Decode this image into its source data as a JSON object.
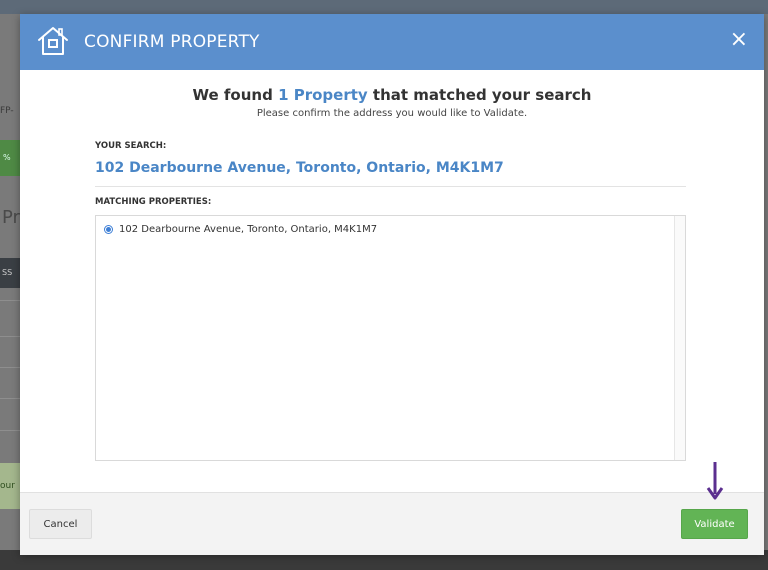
{
  "background": {
    "crumb_text": "FP-",
    "green_text": "%",
    "title_fragment": "Pr",
    "dark_text": "SS",
    "light_green_text": "our"
  },
  "modal": {
    "title": "CONFIRM PROPERTY",
    "close_label": "×",
    "found_prefix": "We found ",
    "found_count": "1 Property",
    "found_suffix": " that matched your search",
    "subtitle": "Please confirm the address you would like to Validate.",
    "your_search_label": "YOUR SEARCH:",
    "search_value": "102 Dearbourne Avenue, Toronto, Ontario, M4K1M7",
    "matching_label": "MATCHING PROPERTIES:",
    "matches": [
      {
        "label": "102 Dearbourne Avenue, Toronto, Ontario, M4K1M7",
        "selected": true
      }
    ],
    "cancel_label": "Cancel",
    "validate_label": "Validate"
  },
  "icons": {
    "header": "home-icon",
    "close": "close-icon",
    "pointer": "down-arrow-icon"
  },
  "colors": {
    "header": "#5b8fcd",
    "accent_text": "#4a86c6",
    "validate": "#62b455",
    "arrow": "#5b2f8f"
  }
}
